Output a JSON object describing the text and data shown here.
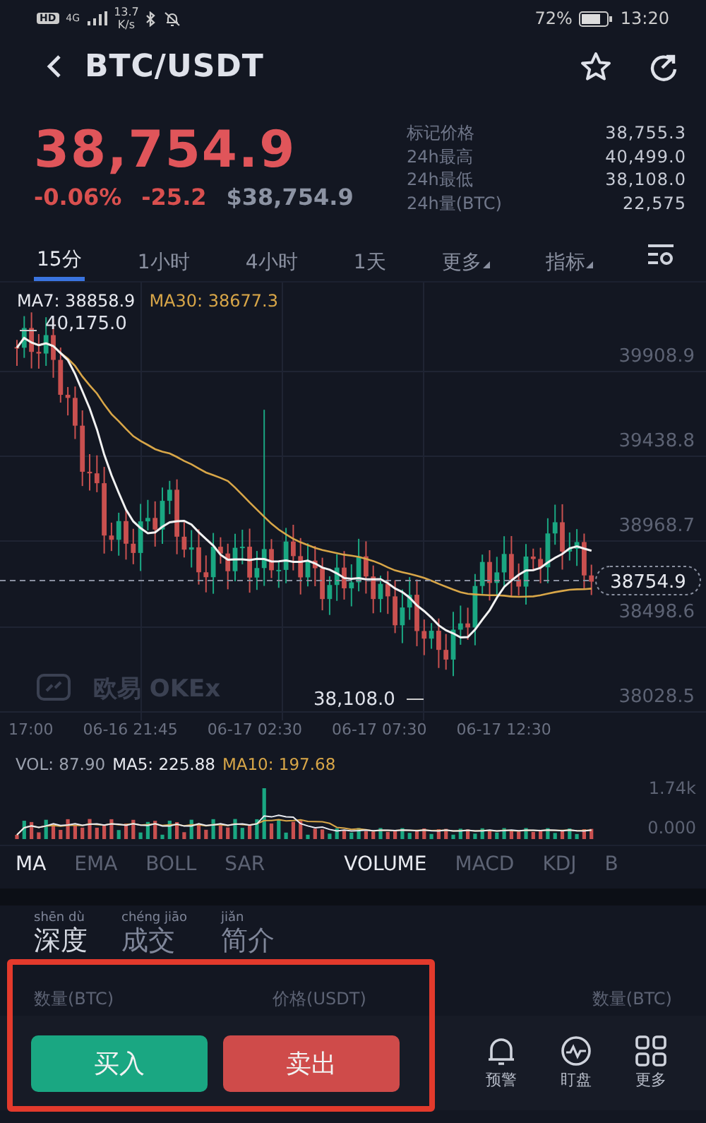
{
  "status_bar": {
    "hd": "HD",
    "network": "4G",
    "speed": [
      "13.7",
      "K/s"
    ],
    "battery": "72%",
    "time": "13:20"
  },
  "header": {
    "title": "BTC/USDT"
  },
  "price": {
    "last": "38,754.9",
    "change_pct": "-0.06%",
    "change": "-25.2",
    "usd": "$38,754.9"
  },
  "stats": [
    {
      "label": "标记价格",
      "value": "38,755.3"
    },
    {
      "label": "24h最高",
      "value": "40,499.0"
    },
    {
      "label": "24h最低",
      "value": "38,108.0"
    },
    {
      "label": "24h量(BTC)",
      "value": "22,575"
    }
  ],
  "tabs": [
    {
      "label": "15分",
      "selected": true,
      "dropdown": false
    },
    {
      "label": "1小时",
      "selected": false,
      "dropdown": false
    },
    {
      "label": "4小时",
      "selected": false,
      "dropdown": false
    },
    {
      "label": "1天",
      "selected": false,
      "dropdown": false
    },
    {
      "label": "更多",
      "selected": false,
      "dropdown": true
    },
    {
      "label": "指标",
      "selected": false,
      "dropdown": true
    }
  ],
  "chart": {
    "legend": [
      {
        "label": "MA7: 38858.9",
        "kind": "ma7"
      },
      {
        "label": "MA30: 38677.3",
        "kind": "ma30"
      }
    ],
    "y_labels": [
      "39908.9",
      "39438.8",
      "38968.7",
      "38498.6",
      "38028.5"
    ],
    "current_price": "38754.9",
    "high_marker": "40,175.0",
    "low_marker": "38,108.0",
    "watermark": "欧易 OKEx",
    "x_labels": [
      "17:00",
      "06-16 21:45",
      "06-17 02:30",
      "06-17 07:30",
      "06-17 12:30"
    ]
  },
  "volume": {
    "legend": [
      {
        "label": "VOL: 87.90",
        "kind": "vol"
      },
      {
        "label": "MA5: 225.88",
        "kind": "ma5"
      },
      {
        "label": "MA10: 197.68",
        "kind": "ma10"
      }
    ],
    "y_labels": [
      "1.74k",
      "0.000"
    ]
  },
  "indicators": [
    {
      "label": "MA",
      "selected": true
    },
    {
      "label": "EMA",
      "selected": false
    },
    {
      "label": "BOLL",
      "selected": false
    },
    {
      "label": "SAR",
      "selected": false
    },
    {
      "label": "VOLUME",
      "selected": true
    },
    {
      "label": "MACD",
      "selected": false
    },
    {
      "label": "KDJ",
      "selected": false
    },
    {
      "label": "B",
      "selected": false
    }
  ],
  "depth_tabs": [
    {
      "label": "深度",
      "pinyin": "shēn dù",
      "selected": true
    },
    {
      "label": "成交",
      "pinyin": "chéng jiāo",
      "selected": false
    },
    {
      "label": "简介",
      "pinyin": "jiǎn",
      "selected": false
    }
  ],
  "depth_columns": [
    "数量(BTC)",
    "价格(USDT)",
    "数量(BTC)"
  ],
  "actions": [
    {
      "label": "买入",
      "kind": "buy"
    },
    {
      "label": "卖出",
      "kind": "sell"
    }
  ],
  "bottom_nav": [
    {
      "label": "预警",
      "kind": "bell"
    },
    {
      "label": "盯盘",
      "kind": "pulse"
    },
    {
      "label": "更多",
      "kind": "grid"
    }
  ]
}
